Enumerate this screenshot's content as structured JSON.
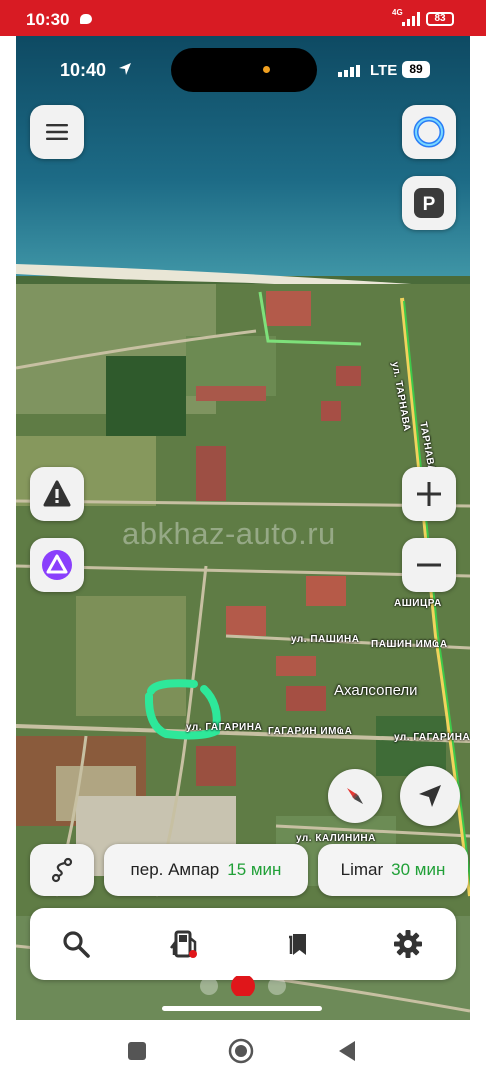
{
  "android_status": {
    "time": "10:30",
    "network": "4G",
    "battery": "83"
  },
  "ios_status": {
    "time": "10:40",
    "network": "LTE",
    "battery": "89"
  },
  "map": {
    "watermark": "abkhaz-auto.ru",
    "labels": {
      "street_tarnava": "ул. ТАРНАВА",
      "street_tarnava_2": "ТАРНАВА",
      "ashitsra": "АШИЦРА",
      "street_pashina": "ул. ПАШИНА",
      "pashin_imqa": "ПАШИН ИМҨА",
      "town": "Ахалсопели",
      "street_gagarina_left": "ул. ГАГАРИНА",
      "gagarin_imqa": "ГАГАРИН ИМҨА",
      "street_gagarina_right": "ул. ГАГАРИНА",
      "kalinina": "ул. КАЛИНИНА"
    }
  },
  "route_chips": [
    {
      "destination": "пер. Ампар",
      "time": "15 мин"
    },
    {
      "destination": "Limar",
      "time": "30 мин"
    }
  ],
  "icons": {
    "menu": "menu-icon",
    "alice": "alice-icon",
    "parking": "parking-icon",
    "parking_letter": "P",
    "alert": "alert-icon",
    "alice_left": "alice-icon",
    "zoom_in": "plus-icon",
    "zoom_out": "minus-icon",
    "compass": "compass-icon",
    "locate": "location-arrow-icon",
    "routes": "route-icon",
    "search": "search-icon",
    "fuel": "fuel-icon",
    "bookmarks": "bookmark-icon",
    "settings": "gear-icon"
  },
  "colors": {
    "android_status_bg": "#d81b23",
    "accent_green": "#21a038",
    "alice_purple": "#8a3ffc",
    "alice_blue": "#2a7cf6",
    "record_red": "#e0161a",
    "highlight_green": "#2ee89a"
  }
}
